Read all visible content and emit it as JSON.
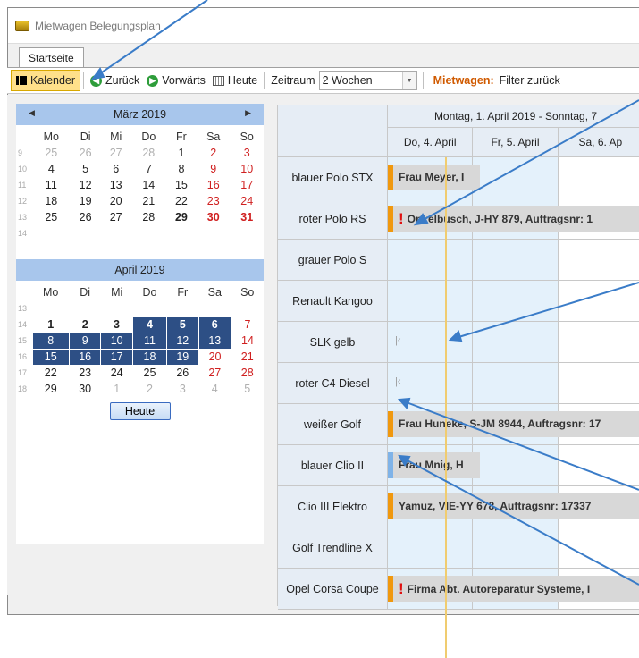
{
  "window": {
    "title": "Mietwagen Belegungsplan"
  },
  "tabs": [
    {
      "label": "Startseite"
    }
  ],
  "toolbar": {
    "kalender": "Kalender",
    "zurueck": "Zurück",
    "vorwaerts": "Vorwärts",
    "heute": "Heute",
    "zeitraum_label": "Zeitraum",
    "zeitraum_value": "2 Wochen",
    "mietwagen_label": "Mietwagen:",
    "filter_text": "Filter zurück"
  },
  "calendar": {
    "march": {
      "title": "März 2019"
    },
    "april": {
      "title": "April 2019"
    },
    "weekday_headers": [
      "Mo",
      "Di",
      "Mi",
      "Do",
      "Fr",
      "Sa",
      "So"
    ],
    "heute_button": "Heute"
  },
  "grid": {
    "range_title": "Montag, 1. April 2019 - Sonntag, 7",
    "day_headers": [
      "Do, 4. April",
      "Fr, 5. April",
      "Sa, 6. Ap"
    ],
    "vehicles": [
      "blauer Polo STX",
      "roter Polo RS",
      "grauer Polo S",
      "Renault Kangoo",
      "SLK gelb",
      "roter C4 Diesel",
      "weißer Golf",
      "blauer Clio II",
      "Clio III Elektro",
      "Golf Trendline X",
      "Opel Corsa Coupe"
    ],
    "bookings": {
      "b0": "Frau Meyer, I",
      "b1": "Onkelbusch, J-HY 879, Auftragsnr: 1",
      "b6": "Frau Huneke, S-JM 8944, Auftragsnr: 17",
      "b7": "Frau Mnig, H",
      "b8": "Yamuz, VIE-YY 678, Auftragsnr: 17337",
      "b10": "Firma Abt. Autoreparatur Systeme, I"
    }
  },
  "colors": {
    "accent_orange": "#f0980e",
    "selected_day": "#2d4f85",
    "month_header": "#a8c6ec",
    "today_line": "#f0cc70",
    "annotation_arrow": "#3a7cc8"
  }
}
